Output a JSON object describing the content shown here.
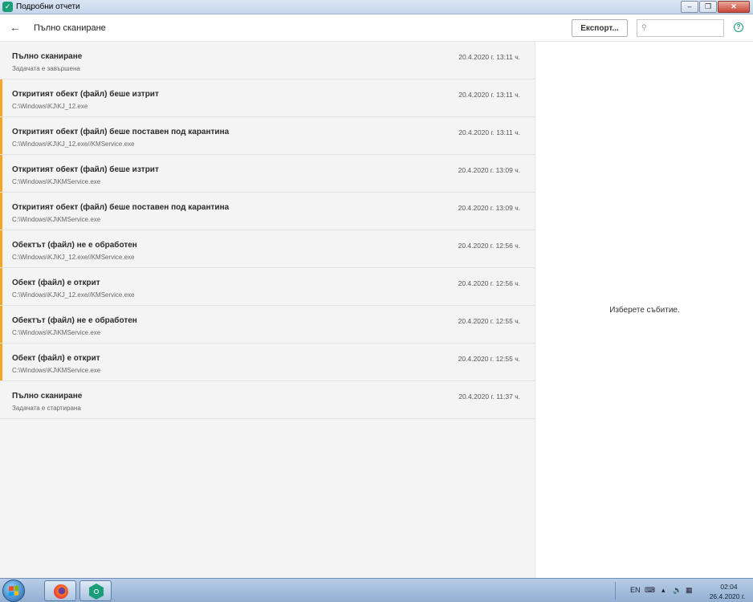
{
  "window": {
    "title": "Подробни отчети"
  },
  "header": {
    "title": "Пълно сканиране",
    "export_label": "Експорт...",
    "search_placeholder": ""
  },
  "events": [
    {
      "title": "Пълно сканиране",
      "subtitle": "Задачата е завършена",
      "time": "20.4.2020 г. 13:11 ч.",
      "flagged": false
    },
    {
      "title": "Откритият обект (файл) беше изтрит",
      "subtitle": "C:\\Windows\\KJ\\KJ_12.exe",
      "time": "20.4.2020 г. 13:11 ч.",
      "flagged": true
    },
    {
      "title": "Откритият обект (файл) беше поставен под карантина",
      "subtitle": "C:\\Windows\\KJ\\KJ_12.exe//KMService.exe",
      "time": "20.4.2020 г. 13:11 ч.",
      "flagged": true
    },
    {
      "title": "Откритият обект (файл) беше изтрит",
      "subtitle": "C:\\Windows\\KJ\\KMService.exe",
      "time": "20.4.2020 г. 13:09 ч.",
      "flagged": true
    },
    {
      "title": "Откритият обект (файл) беше поставен под карантина",
      "subtitle": "C:\\Windows\\KJ\\KMService.exe",
      "time": "20.4.2020 г. 13:09 ч.",
      "flagged": true
    },
    {
      "title": "Обектът (файл) не е обработен",
      "subtitle": "C:\\Windows\\KJ\\KJ_12.exe//KMService.exe",
      "time": "20.4.2020 г. 12:56 ч.",
      "flagged": true
    },
    {
      "title": "Обект (файл) е открит",
      "subtitle": "C:\\Windows\\KJ\\KJ_12.exe//KMService.exe",
      "time": "20.4.2020 г. 12:56 ч.",
      "flagged": true
    },
    {
      "title": "Обектът (файл) не е обработен",
      "subtitle": "C:\\Windows\\KJ\\KMService.exe",
      "time": "20.4.2020 г. 12:55 ч.",
      "flagged": true
    },
    {
      "title": "Обект (файл) е открит",
      "subtitle": "C:\\Windows\\KJ\\KMService.exe",
      "time": "20.4.2020 г. 12:55 ч.",
      "flagged": true
    },
    {
      "title": "Пълно сканиране",
      "subtitle": "Задачата е стартирана",
      "time": "20.4.2020 г. 11:37 ч.",
      "flagged": false
    }
  ],
  "detail": {
    "message": "Изберете събитие."
  },
  "taskbar": {
    "language": "EN",
    "time": "02:04",
    "date": "26.4.2020 г."
  },
  "colors": {
    "accent": "#1a9e7a",
    "warning": "#f5a623"
  },
  "icons": [
    "shield-icon",
    "back-arrow-icon",
    "search-icon",
    "help-icon",
    "firefox-icon",
    "kaspersky-icon",
    "windows-start-icon"
  ]
}
